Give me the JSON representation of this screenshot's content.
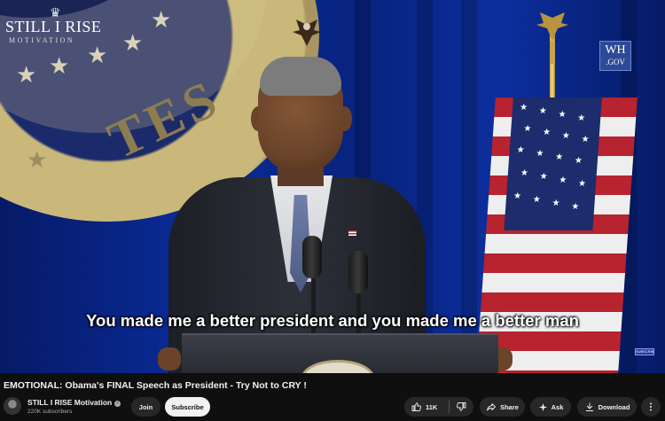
{
  "video": {
    "channel_watermark": {
      "line1": "STILL I RISE",
      "line2": "MOTIVATION"
    },
    "broadcaster_logo": {
      "line1": "WH",
      "line2": ".GOV"
    },
    "seal_text": "TES",
    "subtitle": "You made me a better president and you made me a better man",
    "corner_watermark": "SUBSCRIBE"
  },
  "title": "EMOTIONAL: Obama's FINAL Speech as President - Try Not to CRY !",
  "channel": {
    "name": "STILL I RISE Motivation",
    "subscribers": "220K subscribers",
    "verified_icon": "verified-check-icon"
  },
  "actions": {
    "join": "Join",
    "subscribe": "Subscribe",
    "like_count": "11K",
    "share": "Share",
    "ask": "Ask",
    "download": "Download"
  },
  "icons": [
    "thumbs-up-icon",
    "thumbs-down-icon",
    "share-arrow-icon",
    "sparkle-icon",
    "download-icon",
    "more-vert-icon"
  ],
  "colors": {
    "background": "#0f0f0f",
    "button_bg": "#272727",
    "subscribe_bg": "#f1f1f1",
    "text": "#f1f1f1",
    "muted": "#aaaaaa"
  }
}
